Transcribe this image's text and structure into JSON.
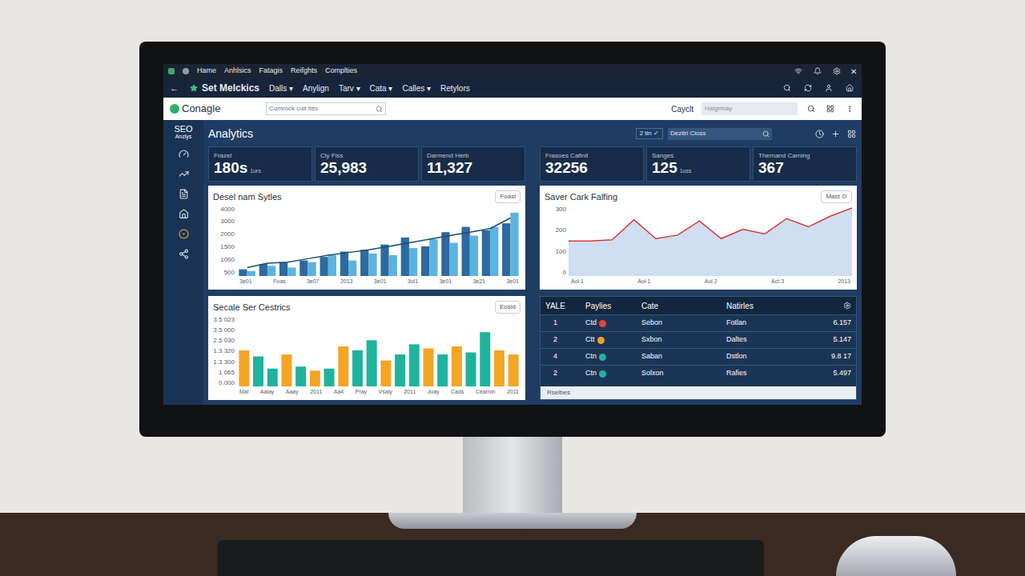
{
  "title_bar": {
    "menu": [
      "Hame",
      "Anhlsics",
      "Fatagis",
      "Reifghts",
      "Complties"
    ],
    "close": "✕"
  },
  "nav_bar": {
    "back": "←",
    "title": "Set Melckics",
    "menus": [
      "Dalls ▾",
      "Anylign",
      "Tarv ▾",
      "Cata ▾",
      "Calles ▾",
      "Retylors"
    ]
  },
  "toolbar": {
    "logo": "Conagle",
    "search": {
      "placeholder": "Comrock cuit ltes"
    },
    "label": "Cayclt",
    "search2": {
      "placeholder": "Halgrmay"
    }
  },
  "sidebar": {
    "title": "SEO",
    "subtitle": "Anzlys"
  },
  "header": {
    "title": "Analytics",
    "filter": "2 tin ✓",
    "search": {
      "placeholder": "Dezilri Cioss"
    }
  },
  "kpis": [
    {
      "label": "Frazel",
      "value": "180s",
      "unit": "1urs"
    },
    {
      "label": "Cly Fiss",
      "value": "25,983",
      "unit": ""
    },
    {
      "label": "Darmend Herb",
      "value": "11,327",
      "unit": ""
    },
    {
      "label": "Frasoes Cafinil",
      "value": "32256",
      "unit": ""
    },
    {
      "label": "Sanges",
      "value": "125",
      "unit": "1uss"
    },
    {
      "label": "Thernand Carning",
      "value": "367",
      "unit": ""
    }
  ],
  "bar_chart": {
    "title": "Desel nam Sytles",
    "button": "Foasl",
    "y_ticks": [
      "4000",
      "3000",
      "2000",
      "1500",
      "1000",
      "500"
    ],
    "x_labels": [
      "3e01",
      "Foas",
      "3e07",
      "2013",
      "3e01",
      "3ul1",
      "3e01",
      "3e21",
      "3e01"
    ],
    "series_dark": [
      400,
      700,
      800,
      900,
      1100,
      1400,
      1500,
      1800,
      2200,
      1700,
      2500,
      2800,
      2600,
      3000
    ],
    "series_light": [
      300,
      600,
      500,
      800,
      1200,
      900,
      1300,
      1200,
      1600,
      2100,
      1900,
      2300,
      2800,
      3600
    ],
    "trend": [
      500,
      750,
      800,
      1000,
      1200,
      1350,
      1500,
      1700,
      1900,
      2100,
      2300,
      2500,
      2700,
      3300
    ]
  },
  "line_chart": {
    "title": "Saver Cark Falfing",
    "button": "Mast ⊙",
    "y_ticks": [
      "300",
      "200",
      "100",
      "0"
    ],
    "x_labels": [
      "Aol 1",
      "Aol 1",
      "Aul 2",
      "Act 3",
      "2013"
    ],
    "values": [
      150,
      150,
      155,
      240,
      160,
      175,
      235,
      160,
      200,
      180,
      245,
      210,
      255,
      290
    ]
  },
  "column_chart": {
    "title": "Secale Ser Cestrics",
    "button": "Eosid",
    "y_ticks": [
      "3.5 023",
      "3.5 000",
      "2.5 030",
      "1.3 320",
      "1.3 300",
      "1 065",
      "0.000"
    ],
    "x_labels": [
      "Mal",
      "Aalay",
      "Aaay",
      "2011",
      "Aa4",
      "Pray",
      "Vsaly",
      "2011",
      "Juay",
      "Cads",
      "Cearnin",
      "2011"
    ],
    "bars": [
      {
        "value": 1.8,
        "color": "#f5a524"
      },
      {
        "value": 1.5,
        "color": "#1fb39d"
      },
      {
        "value": 0.9,
        "color": "#1fb39d"
      },
      {
        "value": 1.6,
        "color": "#f5a524"
      },
      {
        "value": 1.0,
        "color": "#1fb39d"
      },
      {
        "value": 0.8,
        "color": "#f5a524"
      },
      {
        "value": 0.9,
        "color": "#1fb39d"
      },
      {
        "value": 2.0,
        "color": "#f5a524"
      },
      {
        "value": 1.8,
        "color": "#1fb39d"
      },
      {
        "value": 2.3,
        "color": "#1fb39d"
      },
      {
        "value": 1.3,
        "color": "#f5a524"
      },
      {
        "value": 1.6,
        "color": "#1fb39d"
      },
      {
        "value": 2.1,
        "color": "#1fb39d"
      },
      {
        "value": 1.9,
        "color": "#f5a524"
      },
      {
        "value": 1.6,
        "color": "#1fb39d"
      },
      {
        "value": 2.0,
        "color": "#f5a524"
      },
      {
        "value": 1.7,
        "color": "#1fb39d"
      },
      {
        "value": 2.7,
        "color": "#1fb39d"
      },
      {
        "value": 1.8,
        "color": "#f5a524"
      },
      {
        "value": 1.6,
        "color": "#f5a524"
      }
    ]
  },
  "table": {
    "columns": [
      "YALE",
      "Paylies",
      "Cate",
      "Natirles"
    ],
    "rows": [
      {
        "rank": "1",
        "name": "Ctd",
        "color": "#e0463c",
        "cate": "Sebon",
        "natirles": "Fotlan",
        "value": "6.157"
      },
      {
        "rank": "2",
        "name": "Ctt",
        "color": "#f0a030",
        "cate": "Sxbon",
        "natirles": "Daltes",
        "value": "5.147"
      },
      {
        "rank": "4",
        "name": "Ctn",
        "color": "#1fb39d",
        "cate": "Saban",
        "natirles": "Dstlon",
        "value": "9.8 17"
      },
      {
        "rank": "2",
        "name": "Ctn",
        "color": "#1fb39d",
        "cate": "Solxon",
        "natirles": "Rafies",
        "value": "5.497"
      }
    ],
    "footer": "Rselbes"
  }
}
